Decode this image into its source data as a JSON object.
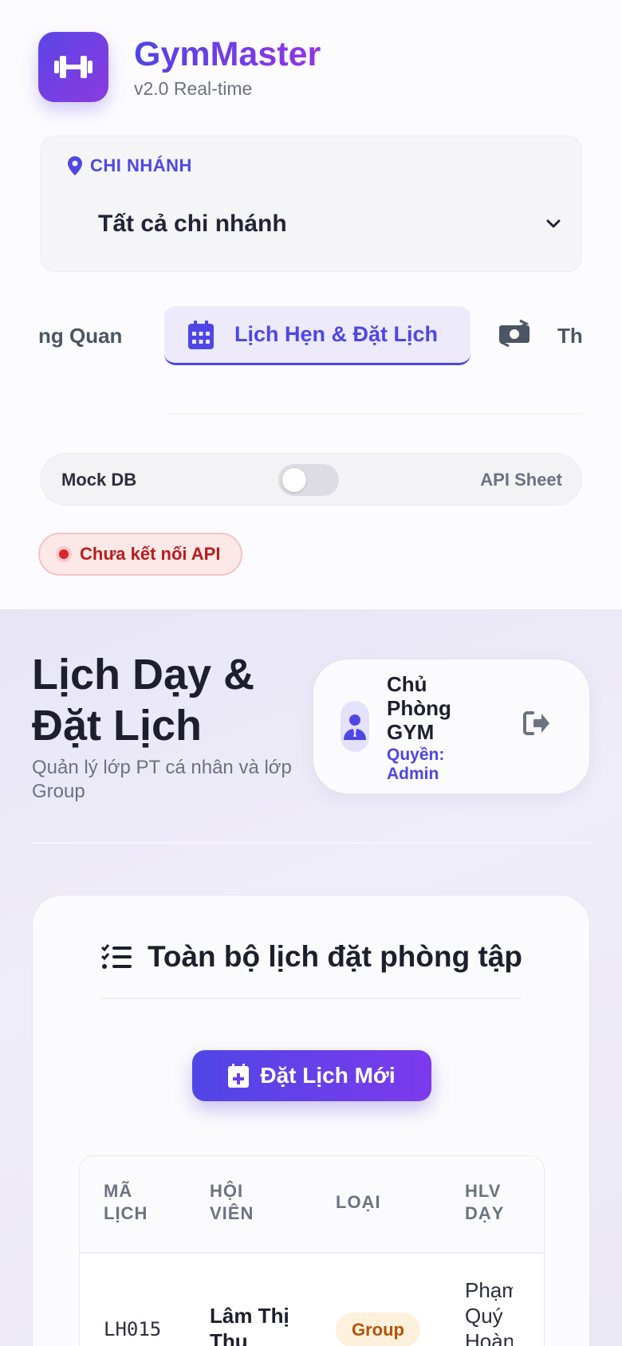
{
  "brand": {
    "name": "GymMaster",
    "version": "v2.0 Real-time",
    "color": "#4f46e5"
  },
  "branch": {
    "label": "CHI NHÁNH",
    "selected": "Tất cả chi nhánh"
  },
  "tabs": [
    {
      "label": "ng Quan",
      "active": false
    },
    {
      "label": "Lịch Hẹn & Đặt Lịch",
      "active": true,
      "icon": "calendar-icon"
    },
    {
      "label": "Th",
      "active": false,
      "icon": "money-icon"
    }
  ],
  "db": {
    "mock_label": "Mock DB",
    "api_label": "API Sheet",
    "api_enabled": false
  },
  "status": {
    "text": "Chưa kết nối API",
    "color": "#dc2626"
  },
  "page": {
    "title": "Lịch Dạy & Đặt Lịch",
    "subtitle": "Quản lý lớp PT cá nhân và lớp Group"
  },
  "user": {
    "name": "Chủ Phòng GYM",
    "role": "Quyền: Admin"
  },
  "section": {
    "title": "Toàn bộ lịch đặt phòng tập",
    "new_button": "Đặt Lịch Mới"
  },
  "table": {
    "headers": [
      "MÃ LỊCH",
      "HỘI VIÊN",
      "LOẠI",
      "HLV DẠY"
    ],
    "rows": [
      {
        "id": "LH015",
        "member": "Lâm Thị Thu",
        "type": "Group",
        "coach": "Phạm Quý Hoàng"
      }
    ]
  }
}
